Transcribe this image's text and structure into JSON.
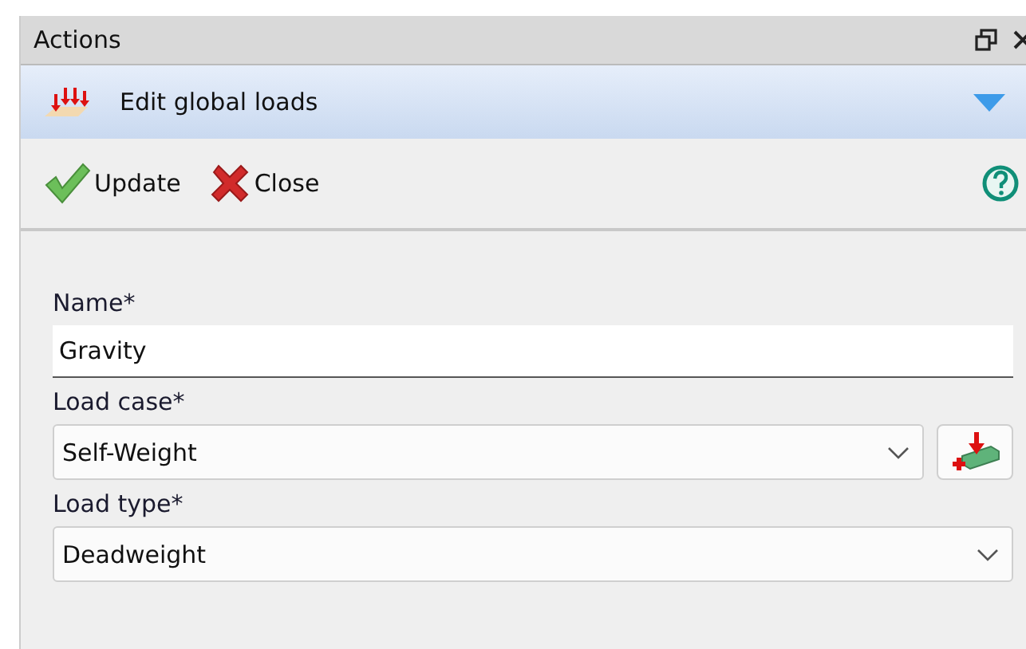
{
  "panel": {
    "title": "Actions"
  },
  "header": {
    "title": "Edit global loads"
  },
  "toolbar": {
    "buttons": [
      {
        "kind": "update",
        "label": "Update"
      },
      {
        "kind": "close",
        "label": "Close"
      }
    ]
  },
  "form": {
    "fields": [
      {
        "kind": "text",
        "label": "Name*",
        "value": "Gravity"
      },
      {
        "kind": "combo-add",
        "label": "Load case*",
        "value": "Self-Weight"
      },
      {
        "kind": "combo",
        "label": "Load type*",
        "value": "Deadweight"
      }
    ]
  }
}
